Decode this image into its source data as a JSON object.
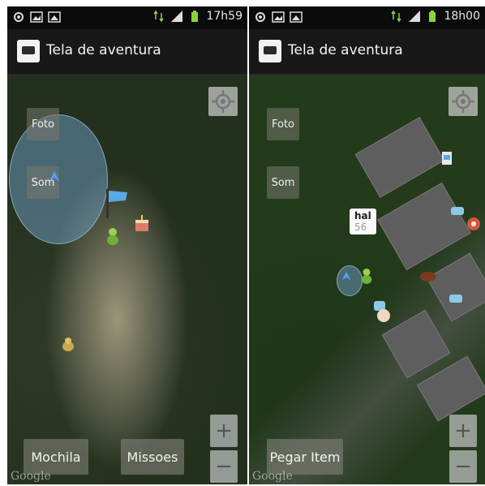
{
  "left": {
    "status": {
      "time": "17h59"
    },
    "title": "Tela de aventura",
    "buttons": {
      "foto": "Foto",
      "som": "Som",
      "mochila": "Mochila",
      "missoes": "Missoes"
    },
    "zoom": {
      "plus": "+",
      "minus": "−"
    },
    "attribution": "Google"
  },
  "right": {
    "status": {
      "time": "18h00"
    },
    "title": "Tela de aventura",
    "buttons": {
      "foto": "Foto",
      "som": "Som",
      "pegar_item": "Pegar Item"
    },
    "popup": {
      "title": "hal",
      "value": "56"
    },
    "zoom": {
      "plus": "+",
      "minus": "−"
    },
    "attribution": "Google"
  },
  "colors": {
    "status_bg": "#0b0b0b",
    "titlebar_bg": "#181818",
    "range_circle": "#78aadc",
    "battery": "#8bd33a"
  },
  "icons": [
    "gps-icon",
    "image-icon",
    "gallery-icon",
    "data-arrows-icon",
    "signal-icon",
    "battery-icon",
    "app-icon",
    "locate-icon",
    "flag-icon",
    "player-icon",
    "cake-icon",
    "item-icon"
  ]
}
